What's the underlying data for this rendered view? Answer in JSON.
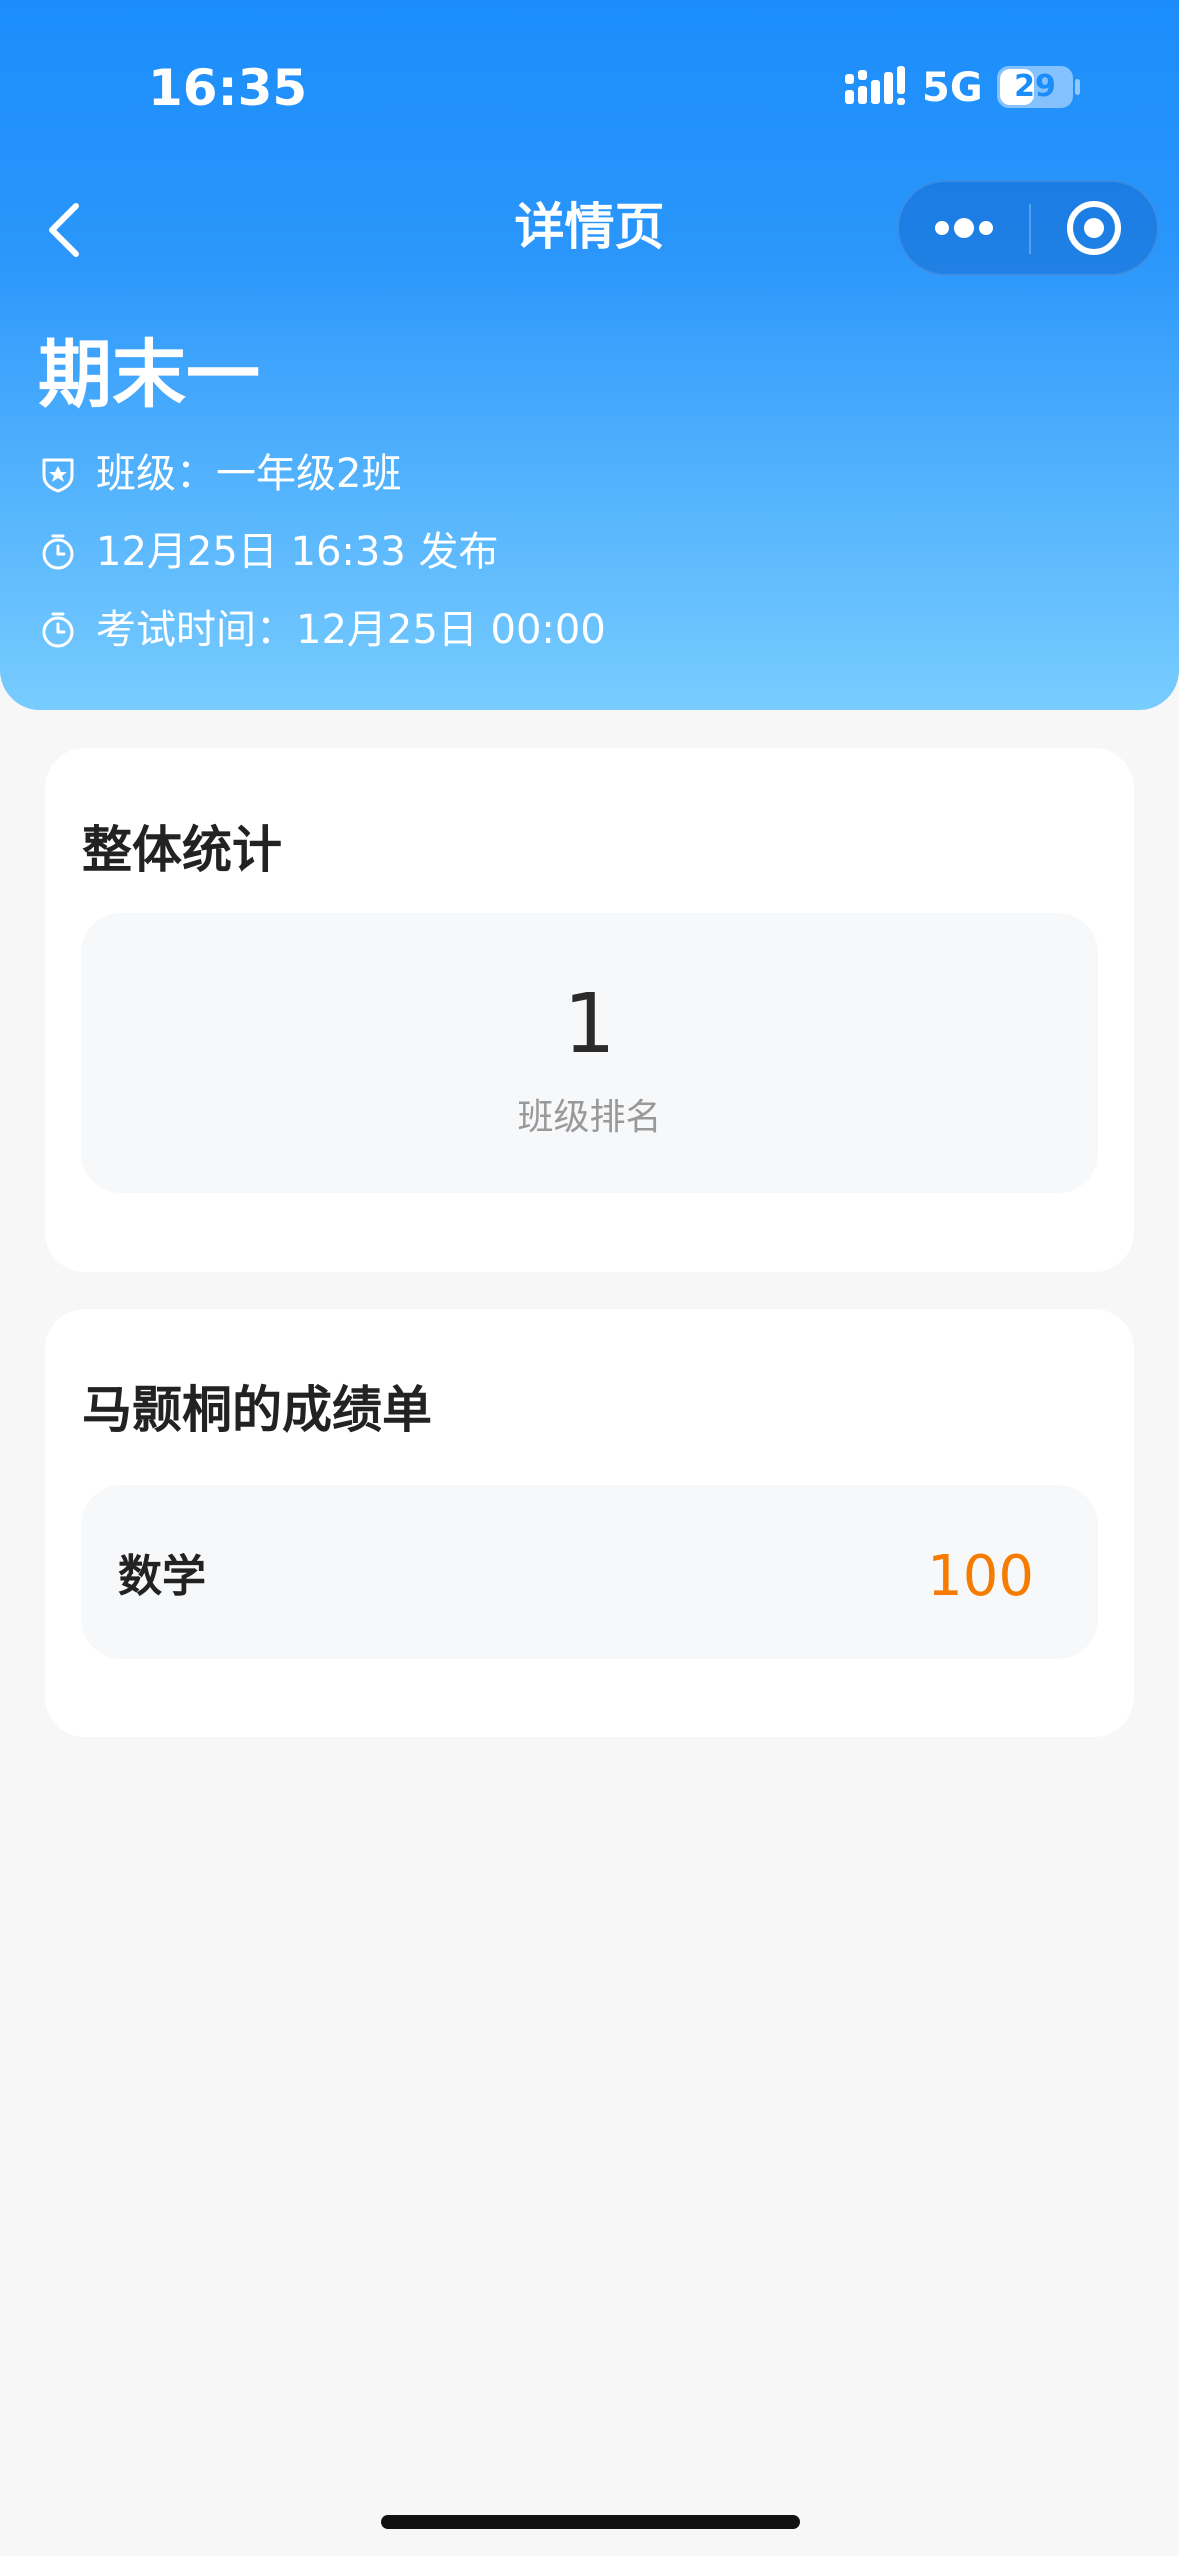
{
  "status_bar": {
    "time": "16:35",
    "network": "5G",
    "battery_level": "29",
    "signal_icon": "signal-bars-icon",
    "battery_icon": "battery-icon"
  },
  "nav": {
    "title": "详情页",
    "back_icon": "chevron-left-icon",
    "more_icon": "more-dots-icon",
    "close_icon": "target-circle-icon"
  },
  "exam": {
    "title": "期末一",
    "class_text": "班级：一年级2班",
    "published_text": "12月25日 16:33 发布",
    "exam_time_text": "考试时间：12月25日 00:00"
  },
  "stats_card": {
    "title": "整体统计",
    "rank_value": "1",
    "rank_label": "班级排名"
  },
  "report_card": {
    "title": "马颢桐的成绩单",
    "rows": [
      {
        "subject": "数学",
        "score": "100"
      }
    ]
  },
  "colors": {
    "header_top": "#1B8DFB",
    "header_bottom": "#78CCFE",
    "score": "#F57C00",
    "background": "#F7F7F7"
  }
}
